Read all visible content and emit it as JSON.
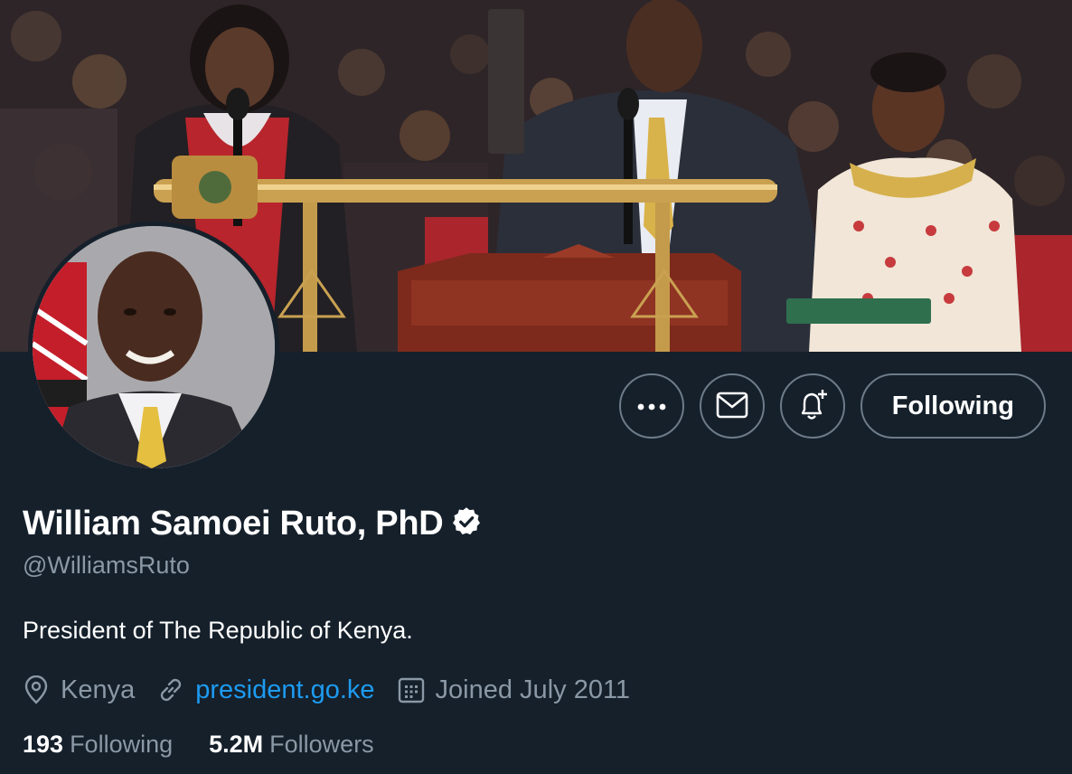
{
  "colors": {
    "background": "#15202b",
    "primary_text": "#ffffff",
    "secondary_text": "#8b98a5",
    "link": "#1d9bf0",
    "button_border": "#6e7b88"
  },
  "banner": {
    "icon": "banner-photo"
  },
  "avatar": {
    "icon": "profile-photo"
  },
  "actions": {
    "more_icon": "more-icon",
    "message_icon": "mail-icon",
    "notify_icon": "bell-plus-icon",
    "follow_label": "Following"
  },
  "profile": {
    "display_name": "William Samoei Ruto, PhD",
    "verified_icon": "verified-badge-icon",
    "handle": "@WilliamsRuto",
    "bio": "President of The Republic of Kenya."
  },
  "meta": {
    "location": "Kenya",
    "website": "president.go.ke",
    "joined": "Joined July 2011"
  },
  "stats": {
    "following_count": "193",
    "following_label": "Following",
    "followers_count": "5.2M",
    "followers_label": "Followers"
  }
}
